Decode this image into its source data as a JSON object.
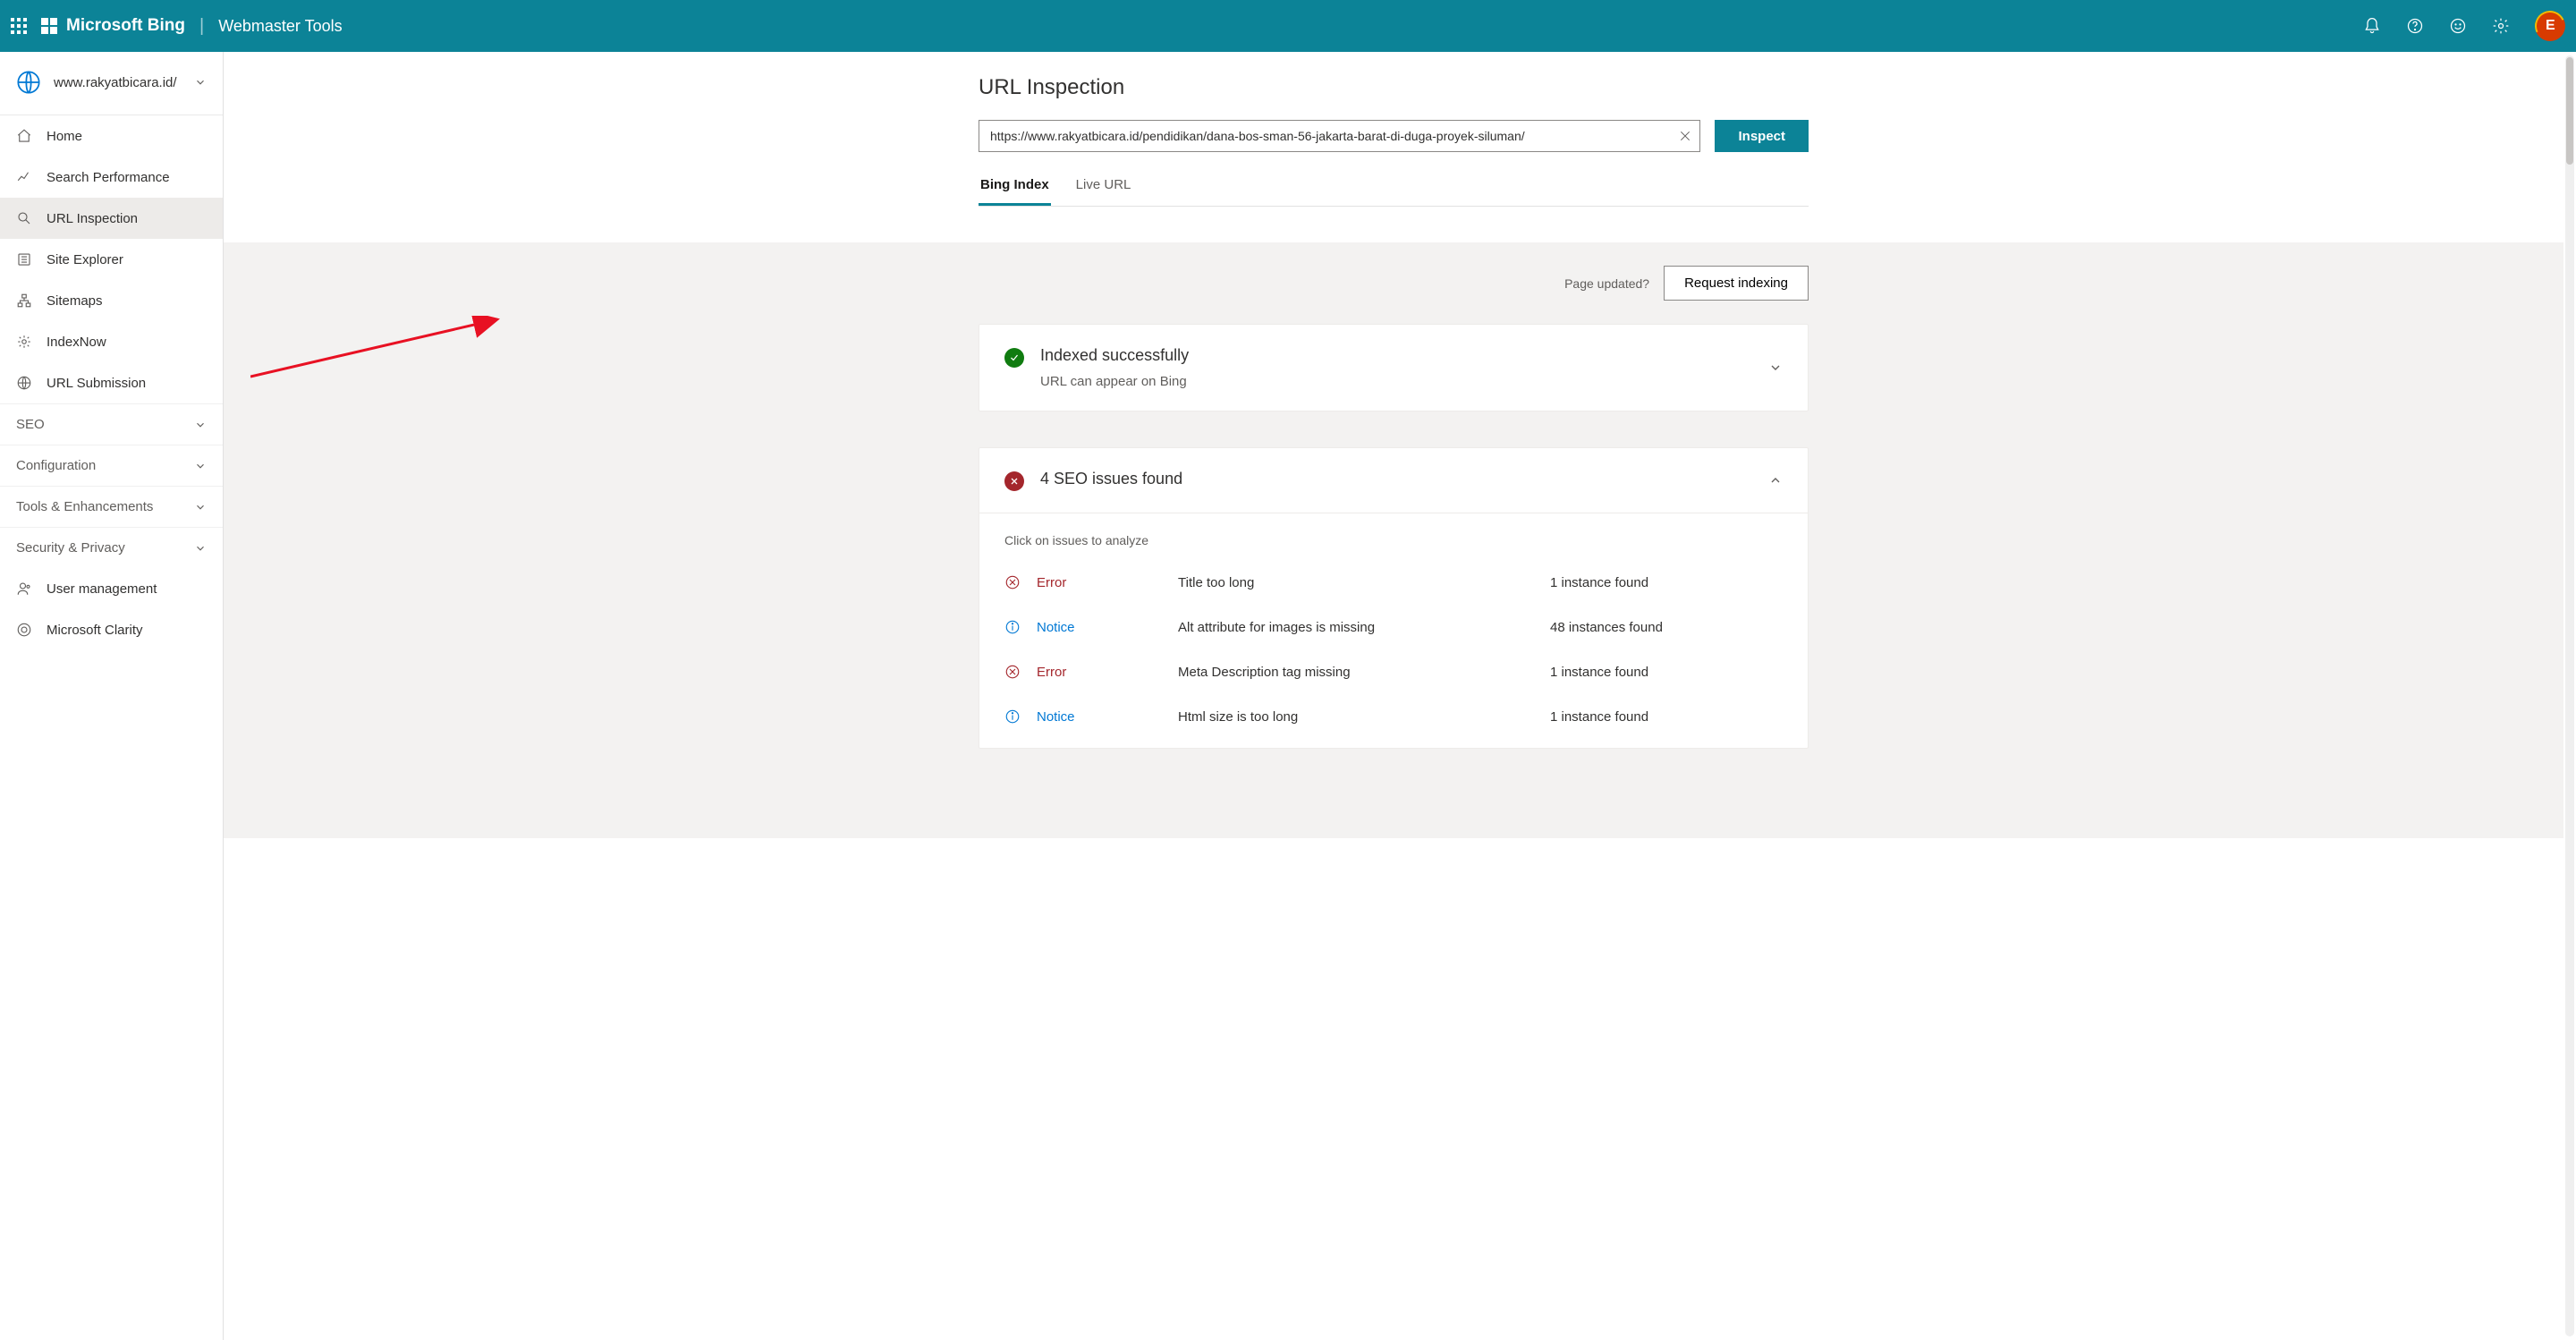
{
  "header": {
    "brand": "Microsoft Bing",
    "subtitle": "Webmaster Tools",
    "avatar_initial": "E"
  },
  "sidebar": {
    "site": "www.rakyatbicara.id/",
    "items": [
      {
        "label": "Home"
      },
      {
        "label": "Search Performance"
      },
      {
        "label": "URL Inspection"
      },
      {
        "label": "Site Explorer"
      },
      {
        "label": "Sitemaps"
      },
      {
        "label": "IndexNow"
      },
      {
        "label": "URL Submission"
      }
    ],
    "groups": [
      {
        "label": "SEO"
      },
      {
        "label": "Configuration"
      },
      {
        "label": "Tools & Enhancements"
      },
      {
        "label": "Security & Privacy"
      }
    ],
    "bottom_items": [
      {
        "label": "User management"
      },
      {
        "label": "Microsoft Clarity"
      }
    ]
  },
  "main": {
    "title": "URL Inspection",
    "url": "https://www.rakyatbicara.id/pendidikan/dana-bos-sman-56-jakarta-barat-di-duga-proyek-siluman/",
    "inspect_label": "Inspect",
    "tabs": [
      {
        "label": "Bing Index"
      },
      {
        "label": "Live URL"
      }
    ],
    "page_updated": "Page updated?",
    "request_indexing": "Request indexing",
    "index_card": {
      "title": "Indexed successfully",
      "subtitle": "URL can appear on Bing"
    },
    "seo_card": {
      "title": "4 SEO issues found",
      "hint": "Click on issues to analyze",
      "issues": [
        {
          "sev": "Error",
          "msg": "Title too long",
          "count": "1 instance found"
        },
        {
          "sev": "Notice",
          "msg": "Alt attribute for images is missing",
          "count": "48 instances found"
        },
        {
          "sev": "Error",
          "msg": "Meta Description tag missing",
          "count": "1 instance found"
        },
        {
          "sev": "Notice",
          "msg": "Html size is too long",
          "count": "1 instance found"
        }
      ]
    }
  }
}
